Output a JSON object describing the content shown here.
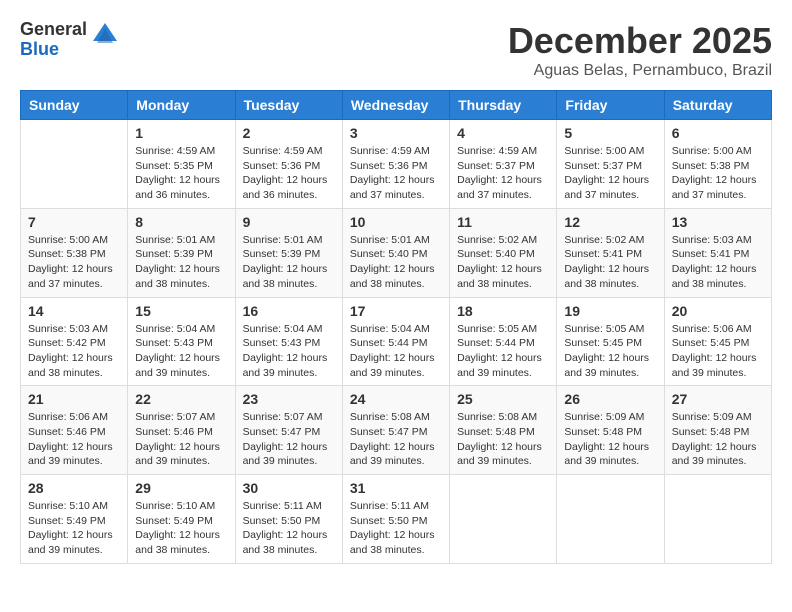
{
  "logo": {
    "general": "General",
    "blue": "Blue"
  },
  "title": "December 2025",
  "subtitle": "Aguas Belas, Pernambuco, Brazil",
  "days_of_week": [
    "Sunday",
    "Monday",
    "Tuesday",
    "Wednesday",
    "Thursday",
    "Friday",
    "Saturday"
  ],
  "weeks": [
    [
      {
        "day": "",
        "info": ""
      },
      {
        "day": "1",
        "info": "Sunrise: 4:59 AM\nSunset: 5:35 PM\nDaylight: 12 hours\nand 36 minutes."
      },
      {
        "day": "2",
        "info": "Sunrise: 4:59 AM\nSunset: 5:36 PM\nDaylight: 12 hours\nand 36 minutes."
      },
      {
        "day": "3",
        "info": "Sunrise: 4:59 AM\nSunset: 5:36 PM\nDaylight: 12 hours\nand 37 minutes."
      },
      {
        "day": "4",
        "info": "Sunrise: 4:59 AM\nSunset: 5:37 PM\nDaylight: 12 hours\nand 37 minutes."
      },
      {
        "day": "5",
        "info": "Sunrise: 5:00 AM\nSunset: 5:37 PM\nDaylight: 12 hours\nand 37 minutes."
      },
      {
        "day": "6",
        "info": "Sunrise: 5:00 AM\nSunset: 5:38 PM\nDaylight: 12 hours\nand 37 minutes."
      }
    ],
    [
      {
        "day": "7",
        "info": "Sunrise: 5:00 AM\nSunset: 5:38 PM\nDaylight: 12 hours\nand 37 minutes."
      },
      {
        "day": "8",
        "info": "Sunrise: 5:01 AM\nSunset: 5:39 PM\nDaylight: 12 hours\nand 38 minutes."
      },
      {
        "day": "9",
        "info": "Sunrise: 5:01 AM\nSunset: 5:39 PM\nDaylight: 12 hours\nand 38 minutes."
      },
      {
        "day": "10",
        "info": "Sunrise: 5:01 AM\nSunset: 5:40 PM\nDaylight: 12 hours\nand 38 minutes."
      },
      {
        "day": "11",
        "info": "Sunrise: 5:02 AM\nSunset: 5:40 PM\nDaylight: 12 hours\nand 38 minutes."
      },
      {
        "day": "12",
        "info": "Sunrise: 5:02 AM\nSunset: 5:41 PM\nDaylight: 12 hours\nand 38 minutes."
      },
      {
        "day": "13",
        "info": "Sunrise: 5:03 AM\nSunset: 5:41 PM\nDaylight: 12 hours\nand 38 minutes."
      }
    ],
    [
      {
        "day": "14",
        "info": "Sunrise: 5:03 AM\nSunset: 5:42 PM\nDaylight: 12 hours\nand 38 minutes."
      },
      {
        "day": "15",
        "info": "Sunrise: 5:04 AM\nSunset: 5:43 PM\nDaylight: 12 hours\nand 39 minutes."
      },
      {
        "day": "16",
        "info": "Sunrise: 5:04 AM\nSunset: 5:43 PM\nDaylight: 12 hours\nand 39 minutes."
      },
      {
        "day": "17",
        "info": "Sunrise: 5:04 AM\nSunset: 5:44 PM\nDaylight: 12 hours\nand 39 minutes."
      },
      {
        "day": "18",
        "info": "Sunrise: 5:05 AM\nSunset: 5:44 PM\nDaylight: 12 hours\nand 39 minutes."
      },
      {
        "day": "19",
        "info": "Sunrise: 5:05 AM\nSunset: 5:45 PM\nDaylight: 12 hours\nand 39 minutes."
      },
      {
        "day": "20",
        "info": "Sunrise: 5:06 AM\nSunset: 5:45 PM\nDaylight: 12 hours\nand 39 minutes."
      }
    ],
    [
      {
        "day": "21",
        "info": "Sunrise: 5:06 AM\nSunset: 5:46 PM\nDaylight: 12 hours\nand 39 minutes."
      },
      {
        "day": "22",
        "info": "Sunrise: 5:07 AM\nSunset: 5:46 PM\nDaylight: 12 hours\nand 39 minutes."
      },
      {
        "day": "23",
        "info": "Sunrise: 5:07 AM\nSunset: 5:47 PM\nDaylight: 12 hours\nand 39 minutes."
      },
      {
        "day": "24",
        "info": "Sunrise: 5:08 AM\nSunset: 5:47 PM\nDaylight: 12 hours\nand 39 minutes."
      },
      {
        "day": "25",
        "info": "Sunrise: 5:08 AM\nSunset: 5:48 PM\nDaylight: 12 hours\nand 39 minutes."
      },
      {
        "day": "26",
        "info": "Sunrise: 5:09 AM\nSunset: 5:48 PM\nDaylight: 12 hours\nand 39 minutes."
      },
      {
        "day": "27",
        "info": "Sunrise: 5:09 AM\nSunset: 5:48 PM\nDaylight: 12 hours\nand 39 minutes."
      }
    ],
    [
      {
        "day": "28",
        "info": "Sunrise: 5:10 AM\nSunset: 5:49 PM\nDaylight: 12 hours\nand 39 minutes."
      },
      {
        "day": "29",
        "info": "Sunrise: 5:10 AM\nSunset: 5:49 PM\nDaylight: 12 hours\nand 38 minutes."
      },
      {
        "day": "30",
        "info": "Sunrise: 5:11 AM\nSunset: 5:50 PM\nDaylight: 12 hours\nand 38 minutes."
      },
      {
        "day": "31",
        "info": "Sunrise: 5:11 AM\nSunset: 5:50 PM\nDaylight: 12 hours\nand 38 minutes."
      },
      {
        "day": "",
        "info": ""
      },
      {
        "day": "",
        "info": ""
      },
      {
        "day": "",
        "info": ""
      }
    ]
  ]
}
